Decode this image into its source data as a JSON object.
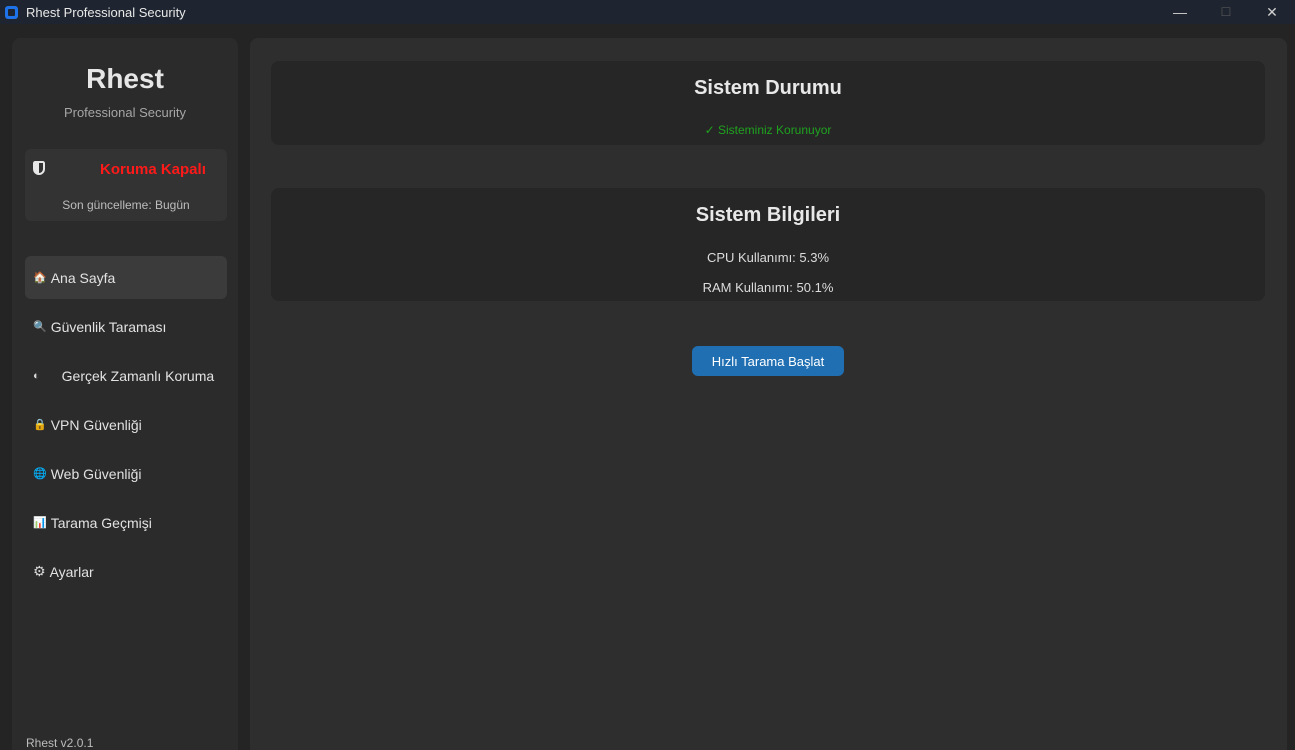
{
  "window": {
    "title": "Rhest Professional Security",
    "controls": {
      "minimize": "—",
      "maximize": "☐",
      "close": "✕"
    }
  },
  "sidebar": {
    "brand": "Rhest",
    "brand_subtitle": "Professional Security",
    "protection_status": {
      "icon": "shield-icon",
      "text": "Koruma Kapalı",
      "text_color": "#ff1a1a",
      "last_update": "Son güncelleme: Bugün"
    },
    "items": [
      {
        "icon": "🏠",
        "label": "Ana Sayfa",
        "active": true
      },
      {
        "icon": "🔍",
        "label": "Güvenlik Taraması"
      },
      {
        "icon": "◐",
        "label": "Gerçek Zamanlı Koruma"
      },
      {
        "icon": "🔒",
        "label": "VPN Güvenliği"
      },
      {
        "icon": "🌐",
        "label": "Web Güvenliği"
      },
      {
        "icon": "📊",
        "label": "Tarama Geçmişi"
      },
      {
        "icon": "⚙",
        "label": "Ayarlar"
      }
    ],
    "version": "Rhest v2.0.1"
  },
  "main": {
    "status_card": {
      "title": "Sistem Durumu",
      "status": "✓ Sisteminiz Korunuyor",
      "status_color": "#1fa21f"
    },
    "info_card": {
      "title": "Sistem Bilgileri",
      "cpu": "CPU Kullanımı: 5.3%",
      "ram": "RAM Kullanımı: 50.1%"
    },
    "quick_scan_button": "Hızlı Tarama Başlat",
    "accent_color": "#1f6fb2"
  }
}
